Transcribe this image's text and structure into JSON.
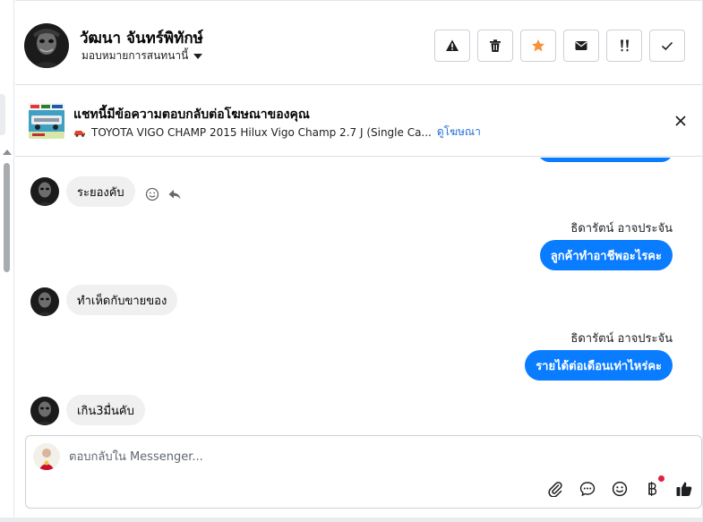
{
  "header": {
    "contact_name": "วัฒนา จันทร์พิทักษ์",
    "assign_label": "มอบหมายการสนทนานี้",
    "actions": [
      "spam-icon",
      "trash-icon",
      "star-icon",
      "mail-icon",
      "follow-up-icon",
      "done-icon"
    ],
    "star_color": "#f7923b"
  },
  "ad_banner": {
    "title": "แชทนี้มีข้อความตอบกลับต่อโฆษณาของคุณ",
    "subtitle": "TOYOTA VIGO CHAMP 2015 Hilux Vigo Champ 2.7 J (Single Ca...",
    "link_label": "ดูโฆษณา"
  },
  "messages": [
    {
      "direction": "in",
      "text": "ระยองคับ"
    },
    {
      "direction": "out",
      "sender": "ธิดารัตน์ อาจประจัน",
      "text": "ลูกค้าทำอาชีพอะไรคะ"
    },
    {
      "direction": "in",
      "text": "ทำเห็ดกับขายของ"
    },
    {
      "direction": "out",
      "sender": "ธิดารัตน์ อาจประจัน",
      "text": "รายได้ต่อเดือนเท่าไหร่คะ"
    },
    {
      "direction": "in",
      "text": "เกิน3มื่นคับ"
    }
  ],
  "composer": {
    "placeholder": "ตอบกลับใน Messenger...",
    "tools": [
      "attach-icon",
      "saved-reply-icon",
      "emoji-icon",
      "payment-icon",
      "like-icon"
    ]
  },
  "colors": {
    "accent": "#0a7cff",
    "link": "#216fdb",
    "incoming_bubble": "#f0f0f0"
  }
}
